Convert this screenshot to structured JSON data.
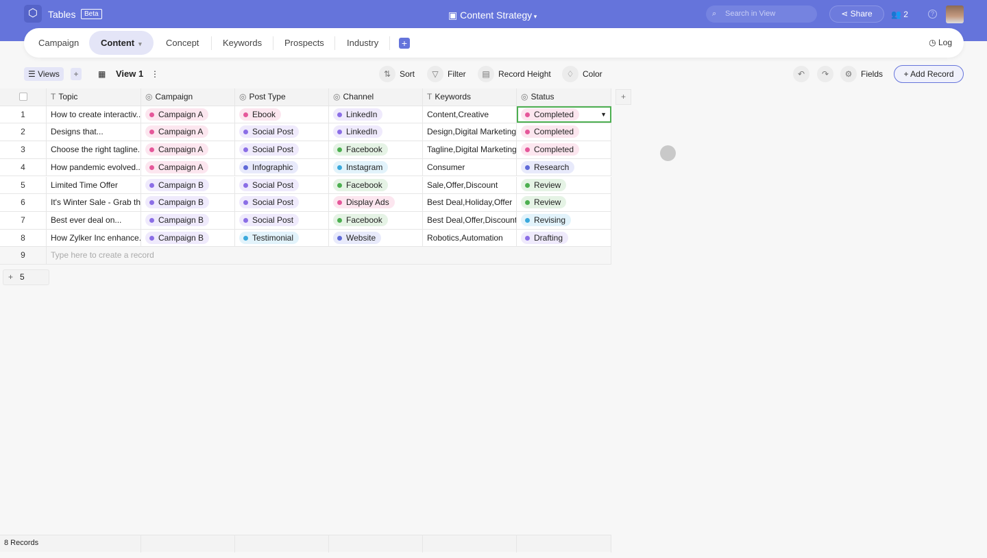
{
  "header": {
    "app_name": "Tables",
    "badge": "Beta",
    "title": "Content Strategy",
    "search_placeholder": "Search in View",
    "share": "Share",
    "collaborators": "2"
  },
  "tabs": [
    "Campaign",
    "Content",
    "Concept",
    "Keywords",
    "Prospects",
    "Industry"
  ],
  "active_tab": "Content",
  "log": "Log",
  "toolbar": {
    "views": "Views",
    "view_name": "View 1",
    "sort": "Sort",
    "filter": "Filter",
    "record_height": "Record Height",
    "color": "Color",
    "fields": "Fields",
    "add_record": "+ Add Record"
  },
  "columns": [
    "Topic",
    "Campaign",
    "Post Type",
    "Channel",
    "Keywords",
    "Status"
  ],
  "colors": {
    "pink": "#e5579a",
    "purple": "#8b6ee6",
    "indigo": "#5f6ad8",
    "cyan": "#3aa9dc",
    "green": "#4caf50",
    "accent": "#6574db"
  },
  "rows": [
    {
      "n": "1",
      "topic": "How to create interactiv...",
      "campaign": [
        "Campaign A",
        "pink"
      ],
      "post": [
        "Ebook",
        "pink"
      ],
      "channel": [
        "LinkedIn",
        "purple"
      ],
      "keywords": "Content,Creative",
      "status": [
        "Completed",
        "pink"
      ]
    },
    {
      "n": "2",
      "topic": "Designs that...",
      "campaign": [
        "Campaign A",
        "pink"
      ],
      "post": [
        "Social Post",
        "purple"
      ],
      "channel": [
        "LinkedIn",
        "purple"
      ],
      "keywords": "Design,Digital Marketing",
      "status": [
        "Completed",
        "pink"
      ]
    },
    {
      "n": "3",
      "topic": "Choose the right tagline...",
      "campaign": [
        "Campaign A",
        "pink"
      ],
      "post": [
        "Social Post",
        "purple"
      ],
      "channel": [
        "Facebook",
        "green"
      ],
      "keywords": "Tagline,Digital Marketing",
      "status": [
        "Completed",
        "pink"
      ]
    },
    {
      "n": "4",
      "topic": "How pandemic evolved...",
      "campaign": [
        "Campaign A",
        "pink"
      ],
      "post": [
        "Infographic",
        "indigo"
      ],
      "channel": [
        "Instagram",
        "cyan"
      ],
      "keywords": "Consumer",
      "status": [
        "Research",
        "indigo"
      ]
    },
    {
      "n": "5",
      "topic": "Limited Time Offer",
      "campaign": [
        "Campaign B",
        "purple"
      ],
      "post": [
        "Social Post",
        "purple"
      ],
      "channel": [
        "Facebook",
        "green"
      ],
      "keywords": "Sale,Offer,Discount",
      "status": [
        "Review",
        "green"
      ]
    },
    {
      "n": "6",
      "topic": "It's Winter Sale - Grab th...",
      "campaign": [
        "Campaign B",
        "purple"
      ],
      "post": [
        "Social Post",
        "purple"
      ],
      "channel": [
        "Display Ads",
        "pink"
      ],
      "keywords": "Best Deal,Holiday,Offer",
      "status": [
        "Review",
        "green"
      ]
    },
    {
      "n": "7",
      "topic": "Best ever deal on...",
      "campaign": [
        "Campaign B",
        "purple"
      ],
      "post": [
        "Social Post",
        "purple"
      ],
      "channel": [
        "Facebook",
        "green"
      ],
      "keywords": "Best Deal,Offer,Discount",
      "status": [
        "Revising",
        "cyan"
      ]
    },
    {
      "n": "8",
      "topic": "How Zylker Inc enhance...",
      "campaign": [
        "Campaign B",
        "purple"
      ],
      "post": [
        "Testimonial",
        "cyan"
      ],
      "channel": [
        "Website",
        "indigo"
      ],
      "keywords": "Robotics,Automation",
      "status": [
        "Drafting",
        "purple"
      ]
    }
  ],
  "new_row": {
    "n": "9",
    "placeholder": "Type here to create a record"
  },
  "pager": "5",
  "record_count": "8 Records"
}
